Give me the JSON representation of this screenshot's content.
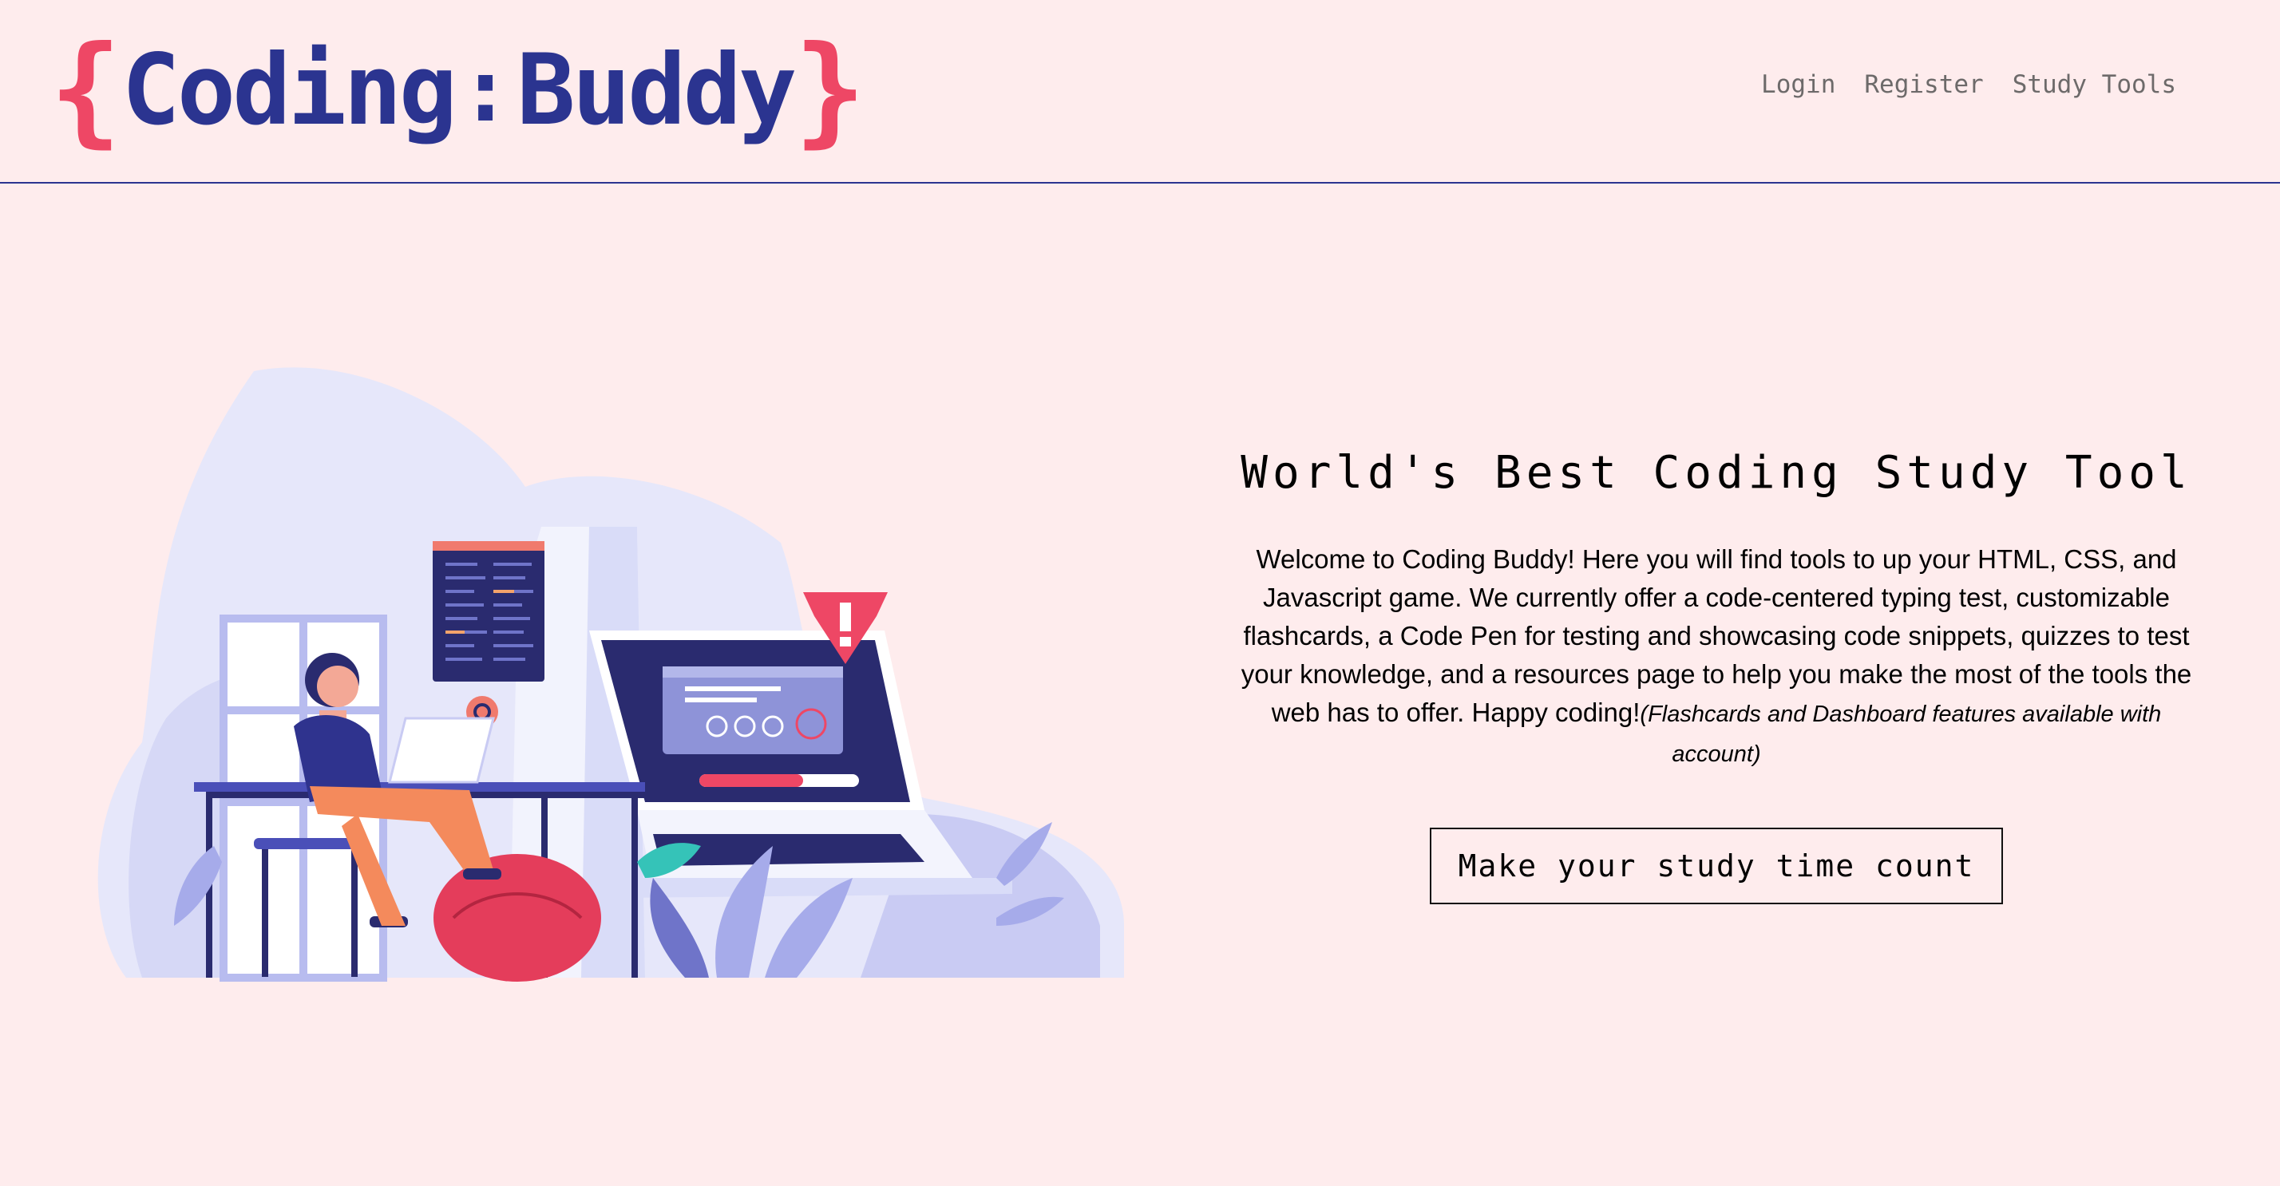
{
  "logo": {
    "open_brace": "{",
    "word1": "Coding",
    "colon": ":",
    "word2": "Buddy",
    "close_brace": "}"
  },
  "nav": {
    "login": "Login",
    "register": "Register",
    "study_tools": "Study Tools"
  },
  "hero": {
    "title": "World's Best Coding Study Tool",
    "description": "Welcome to Coding Buddy! Here you will find tools to up your HTML, CSS, and Javascript game. We currently offer a code-centered typing test, customizable flashcards, a Code Pen for testing and showcasing code snippets, quizzes to test your knowledge, and a resources page to help you make the most of the tools the web has to offer. Happy coding!",
    "note": "(Flashcards and Dashboard features available with account)",
    "cta_label": "Make your study time count"
  },
  "colors": {
    "background": "#feeced",
    "brand_blue": "#2b3490",
    "brand_red": "#ee4765",
    "nav_text": "#6d6a6a"
  },
  "illustration": {
    "subject": "woman-coding-at-desk-with-laptop-illustration"
  }
}
